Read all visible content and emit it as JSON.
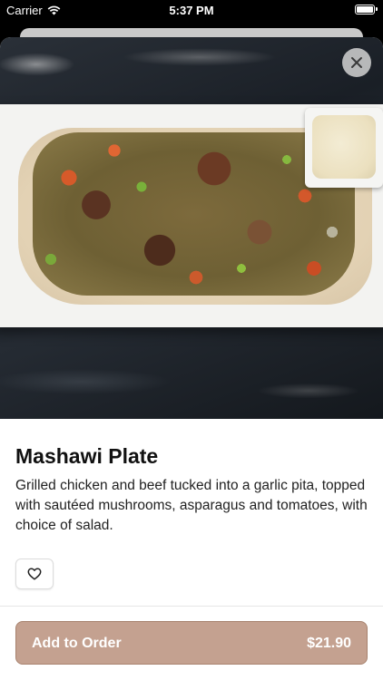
{
  "status_bar": {
    "carrier": "Carrier",
    "time": "5:37 PM",
    "wifi_icon": "wifi-icon",
    "battery_icon": "battery-icon"
  },
  "item": {
    "name": "Mashawi Plate",
    "description": "Grilled chicken and beef tucked into a garlic pita, topped with sautéed mushrooms, asparagus and tomatoes, with choice of salad.",
    "image": "food-photo"
  },
  "actions": {
    "close_icon": "close-icon",
    "favorite_icon": "heart-icon",
    "add_to_order_label": "Add to Order",
    "price": "$21.90"
  },
  "colors": {
    "accent": "#c4a190",
    "accent_border": "#a8836f",
    "text": "#111111"
  }
}
